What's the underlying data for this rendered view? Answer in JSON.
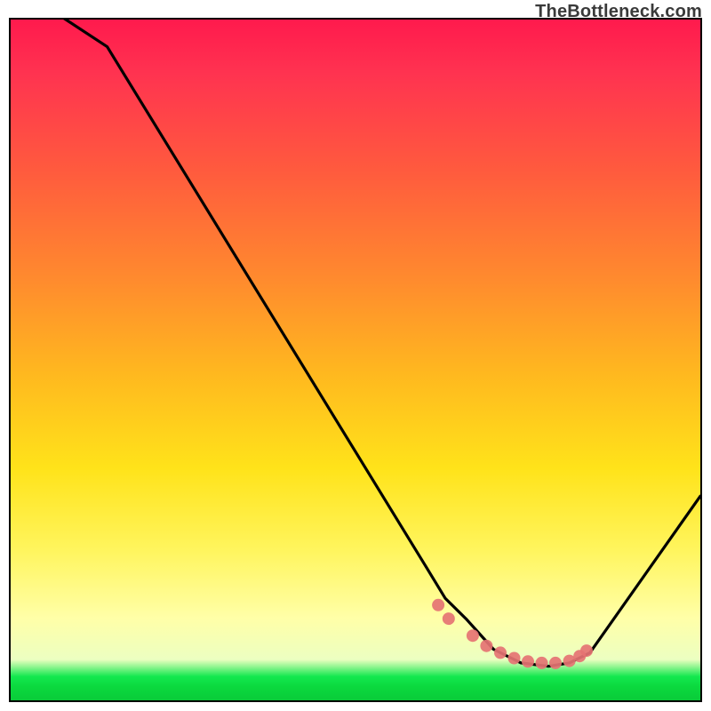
{
  "watermark": "TheBottleneck.com",
  "chart_data": {
    "type": "line",
    "title": "",
    "xlabel": "",
    "ylabel": "",
    "xlim": [
      0,
      100
    ],
    "ylim": [
      0,
      100
    ],
    "series": [
      {
        "name": "bottleneck-curve",
        "x": [
          0,
          8,
          14,
          60,
          63,
          66,
          70,
          74,
          78,
          81,
          84,
          100
        ],
        "values": [
          105,
          100,
          96,
          20,
          15,
          12,
          7.5,
          5.5,
          5,
          5.5,
          7,
          30
        ]
      }
    ],
    "markers": {
      "name": "highlight-points",
      "color": "#e57373",
      "x": [
        62,
        63.5,
        67,
        69,
        71,
        73,
        75,
        77,
        79,
        81,
        82.5,
        83.5
      ],
      "values": [
        14,
        12,
        9.5,
        8,
        7,
        6.2,
        5.7,
        5.5,
        5.5,
        5.8,
        6.5,
        7.3
      ]
    },
    "colors": {
      "curve": "#000000",
      "marker_fill": "#e57373",
      "gradient_top": "#ff1a4d",
      "gradient_mid": "#ffe31a",
      "gradient_bottom": "#0acb39"
    }
  }
}
